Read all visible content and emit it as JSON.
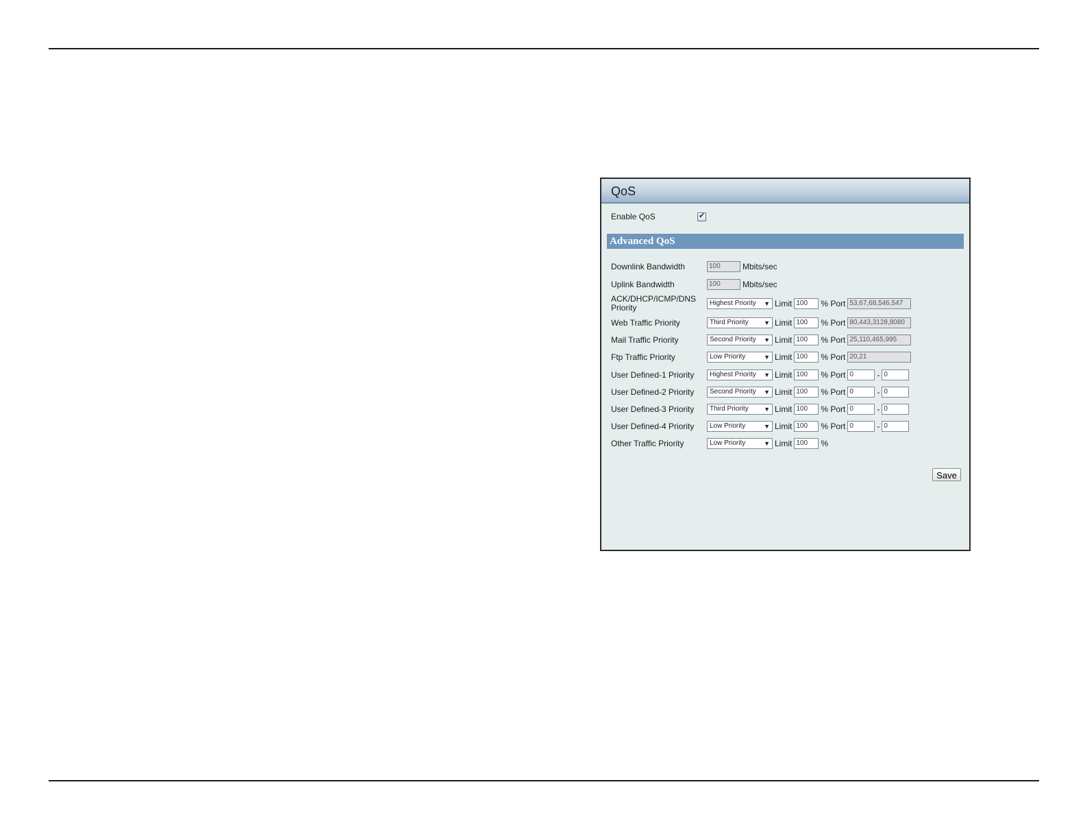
{
  "panel": {
    "title": "QoS",
    "enable": {
      "label": "Enable QoS",
      "checked": true
    },
    "section_title": "Advanced QoS",
    "downlink": {
      "label": "Downlink Bandwidth",
      "value": "100",
      "unit": "Mbits/sec"
    },
    "uplink": {
      "label": "Uplink Bandwidth",
      "value": "100",
      "unit": "Mbits/sec"
    },
    "limit_label": "Limit",
    "percent_port_label": "% Port",
    "percent_label": "%",
    "dash": "-",
    "rows": [
      {
        "label": "ACK/DHCP/ICMP/DNS Priority",
        "priority": "Highest Priority",
        "limit": "100",
        "port": "53,67,68,546,547"
      },
      {
        "label": "Web Traffic Priority",
        "priority": "Third Priority",
        "limit": "100",
        "port": "80,443,3128,8080"
      },
      {
        "label": "Mail Traffic Priority",
        "priority": "Second Priority",
        "limit": "100",
        "port": "25,110,465,995"
      },
      {
        "label": "Ftp Traffic Priority",
        "priority": "Low Priority",
        "limit": "100",
        "port": "20,21"
      },
      {
        "label": "User Defined-1 Priority",
        "priority": "Highest Priority",
        "limit": "100",
        "port_from": "0",
        "port_to": "0"
      },
      {
        "label": "User Defined-2 Priority",
        "priority": "Second Priority",
        "limit": "100",
        "port_from": "0",
        "port_to": "0"
      },
      {
        "label": "User Defined-3 Priority",
        "priority": "Third Priority",
        "limit": "100",
        "port_from": "0",
        "port_to": "0"
      },
      {
        "label": "User Defined-4 Priority",
        "priority": "Low Priority",
        "limit": "100",
        "port_from": "0",
        "port_to": "0"
      },
      {
        "label": "Other Traffic Priority",
        "priority": "Low Priority",
        "limit": "100"
      }
    ],
    "save_label": "Save"
  }
}
